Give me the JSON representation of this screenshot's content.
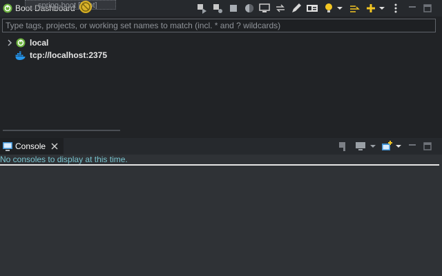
{
  "boot_dashboard": {
    "title": "Boot Dashboard",
    "drag_ghost_text": "spring-boot [boot]",
    "filter_placeholder": "Type tags, projects, or working set names to match (incl. * and ? wildcards)",
    "tree": [
      {
        "label": "local",
        "icon": "spring-boot-icon",
        "expandable": true
      },
      {
        "label": "tcp://localhost:2375",
        "icon": "docker-whale-icon",
        "expandable": false
      }
    ],
    "toolbar_icons": [
      "start-icon",
      "debug-icon",
      "stop-icon",
      "theme-icon",
      "monitor-icon",
      "sync-icon",
      "pencil-icon",
      "id-card-icon",
      "bulb-icon",
      "chevron-down-icon",
      "link-icon",
      "add-icon",
      "chevron-down-icon",
      "view-menu-icon",
      "minimize-icon",
      "maximize-icon"
    ]
  },
  "console": {
    "title": "Console",
    "message": "No consoles to display at this time.",
    "toolbar_icons": [
      "pin-console-icon",
      "display-console-icon",
      "chevron-down-icon",
      "open-console-icon",
      "chevron-down-icon",
      "minimize-icon",
      "maximize-icon"
    ]
  },
  "colors": {
    "accent_yellow": "#f3c623",
    "spring_green": "#6db33f",
    "docker_blue": "#2496ed",
    "console_message": "#79c5d0"
  }
}
